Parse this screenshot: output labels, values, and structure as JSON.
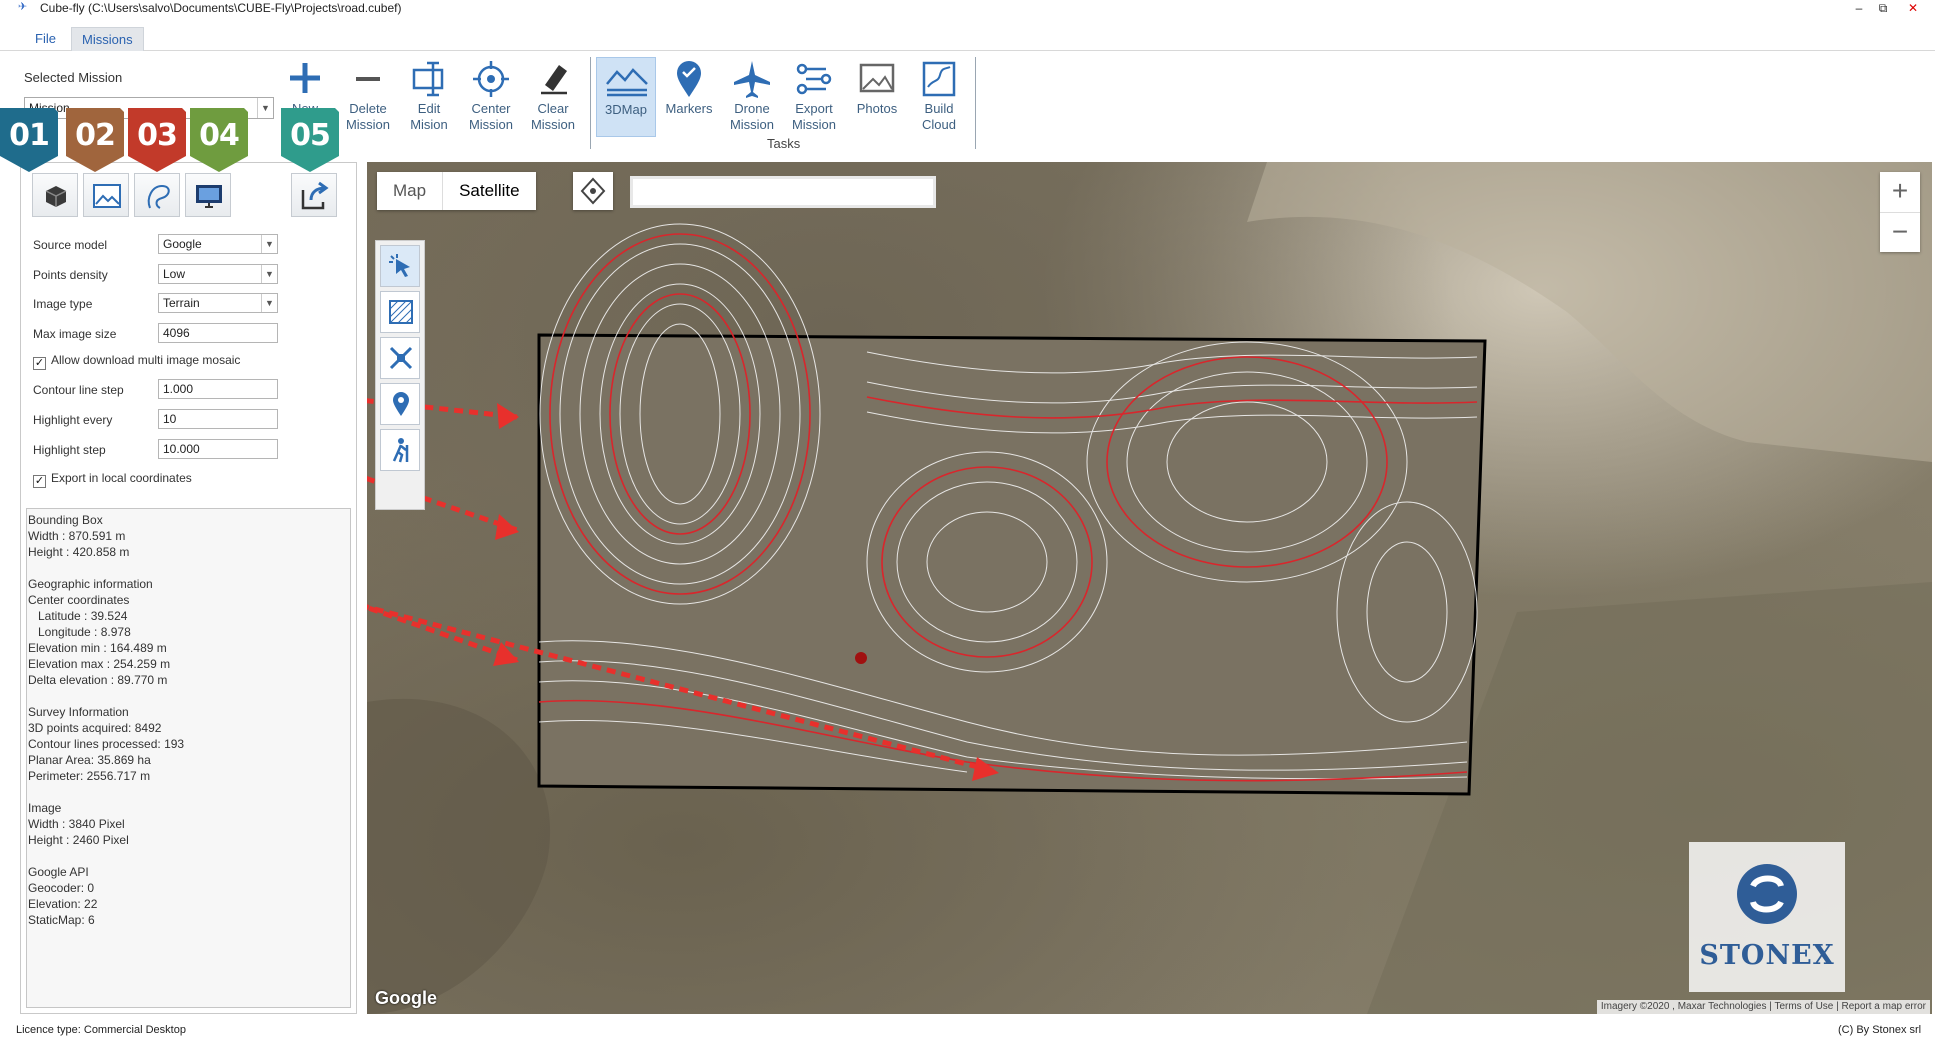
{
  "window": {
    "title": "Cube-fly (C:\\Users\\salvo\\Documents\\CUBE-Fly\\Projects\\road.cubef)",
    "minimize": "‒",
    "restore": "⧉",
    "close": "✕"
  },
  "menu": {
    "file": "File",
    "missions": "Missions"
  },
  "ribbon": {
    "selected_mission_label": "Selected Mission",
    "mission_select_value": "Mission",
    "tasks_label": "Tasks",
    "buttons": {
      "new": "New",
      "delete": [
        "Delete",
        "Mission"
      ],
      "edit": [
        "Edit",
        "Mision"
      ],
      "center": [
        "Center",
        "Mission"
      ],
      "clear": [
        "Clear",
        "Mission"
      ],
      "map3d": "3DMap",
      "markers": "Markers",
      "drone": [
        "Drone",
        "Mission"
      ],
      "export": [
        "Export",
        "Mission"
      ],
      "photos": "Photos",
      "build": [
        "Build",
        "Cloud"
      ]
    },
    "trimmed_label": "M"
  },
  "badges": [
    "01",
    "02",
    "03",
    "04",
    "05"
  ],
  "form": {
    "source_model": {
      "label": "Source model",
      "value": "Google"
    },
    "points_density": {
      "label": "Points density",
      "value": "Low"
    },
    "image_type": {
      "label": "Image type",
      "value": "Terrain"
    },
    "max_image_size": {
      "label": "Max image size",
      "value": "4096"
    },
    "allow_mosaic": {
      "label": "Allow download multi image mosaic",
      "checked": true
    },
    "contour_line_step": {
      "label": "Contour line step",
      "value": "1.000"
    },
    "highlight_every": {
      "label": "Highlight every",
      "value": "10"
    },
    "highlight_step": {
      "label": "Highlight step",
      "value": "10.000"
    },
    "export_local": {
      "label": "Export in local coordinates",
      "checked": true
    }
  },
  "info": [
    "Bounding Box",
    "Width : 870.591 m",
    "Height : 420.858 m",
    "",
    "Geographic information",
    "Center coordinates",
    "   Latitude : 39.524",
    "   Longitude : 8.978",
    "Elevation min : 164.489 m",
    "Elevation max : 254.259 m",
    "Delta elevation : 89.770 m",
    "",
    "Survey Information",
    "3D points acquired: 8492",
    "Contour lines processed: 193",
    "Planar Area: 35.869 ha",
    "Perimeter: 2556.717 m",
    "",
    "Image",
    "Width : 3840 Pixel",
    "Height : 2460 Pixel",
    "",
    "Google API",
    "Geocoder: 0",
    "Elevation: 22",
    "StaticMap: 6"
  ],
  "map": {
    "map_tab": "Map",
    "satellite_tab": "Satellite",
    "selected_type": "Satellite",
    "search_value": "",
    "zoom_in": "+",
    "zoom_out": "−",
    "google_logo": "Google",
    "attribution": "Imagery ©2020 , Maxar Technologies  |  Terms of Use  |  Report a map error",
    "watermark": "STONEX",
    "colors": {
      "contour_minor": "#f2f2f2",
      "contour_major": "#d9262c",
      "annotation_arrow": "#e8302c"
    }
  },
  "status": {
    "licence": "Licence type: Commercial Desktop",
    "copyright": "(C) By Stonex srl"
  },
  "colors": {
    "badge_01": "#1f6c8c",
    "badge_02": "#a0653d",
    "badge_03": "#c23a2a",
    "badge_04": "#6f9c3f",
    "badge_05": "#2f9c8c",
    "accent": "#2a62b0"
  }
}
